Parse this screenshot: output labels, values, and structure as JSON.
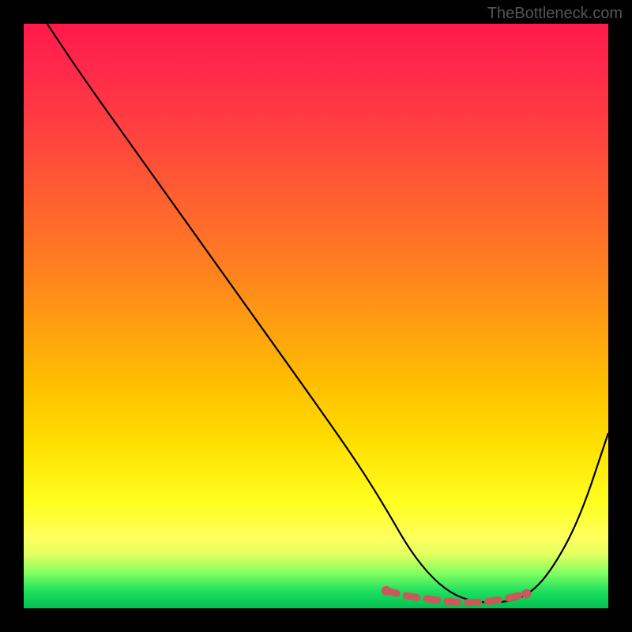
{
  "watermark": "TheBottleneck.com",
  "chart_data": {
    "type": "line",
    "title": "",
    "xlabel": "",
    "ylabel": "",
    "xlim": [
      0,
      100
    ],
    "ylim": [
      0,
      100
    ],
    "series": [
      {
        "name": "curve",
        "x": [
          4,
          10,
          20,
          30,
          40,
          50,
          57,
          62,
          66,
          70,
          74,
          78,
          82,
          86,
          90,
          95,
          100
        ],
        "values": [
          100,
          91,
          77,
          63,
          49,
          35,
          25,
          17,
          10,
          5,
          2,
          1,
          1,
          2,
          6,
          15,
          30
        ]
      }
    ],
    "markers": {
      "name": "low-segment",
      "color": "#c85a5a",
      "x": [
        62,
        66,
        70,
        74,
        78,
        82,
        86
      ],
      "values": [
        3,
        2,
        1.5,
        1,
        1,
        1.5,
        2.5
      ]
    },
    "gradient_stops": [
      {
        "pos": 0,
        "color": "#ff1a4a"
      },
      {
        "pos": 50,
        "color": "#ffb000"
      },
      {
        "pos": 85,
        "color": "#ffff40"
      },
      {
        "pos": 100,
        "color": "#00c050"
      }
    ]
  }
}
